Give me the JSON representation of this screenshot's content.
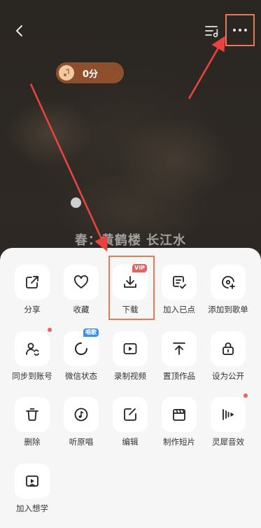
{
  "player": {
    "score": "0分",
    "lyric": "春：黄鹤楼 长江水"
  },
  "icons": {
    "back": "chevron-left-icon",
    "playlist": "playlist-icon",
    "more": "more-dots-icon"
  },
  "colors": {
    "accent": "#e47b56",
    "badge_red": "#e5625d",
    "badge_blue": "#3d8cf0",
    "sheet_bg": "#f6f6f6"
  },
  "menu": {
    "share": "分享",
    "favorite": "收藏",
    "download": "下载",
    "download_badge": "VIP",
    "add_played": "加入已点",
    "add_to_playlist": "添加到歌单",
    "sync_account": "同步到账号",
    "wechat_status": "微信状态",
    "wechat_badge": "唱歌",
    "record_video": "录制视频",
    "pin_work": "置顶作品",
    "set_public": "设为公开",
    "delete": "删除",
    "listen_original": "听原唱",
    "edit": "编辑",
    "make_short": "制作短片",
    "sound_effect": "灵犀音效",
    "add_to_learn": "加入想学"
  }
}
